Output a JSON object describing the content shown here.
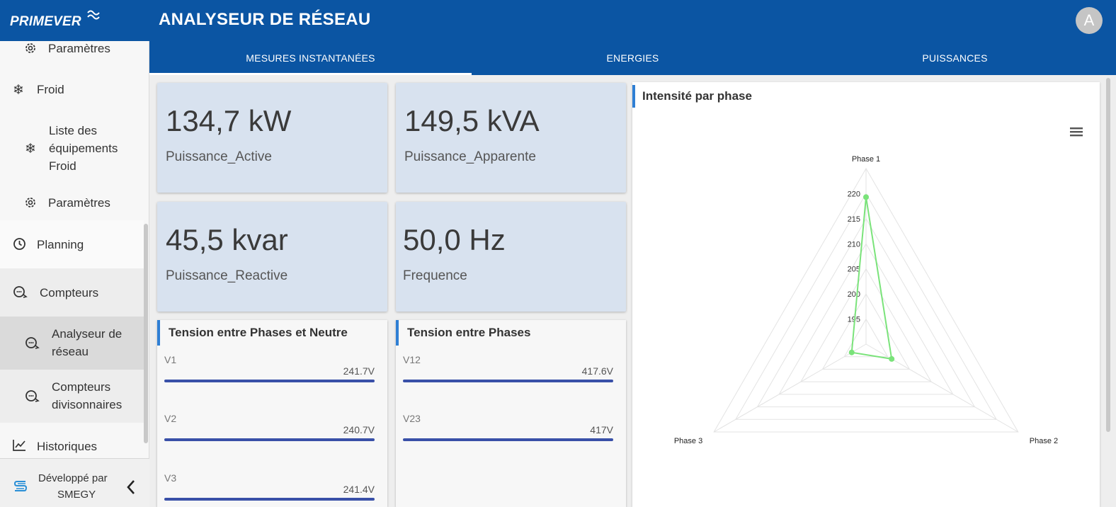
{
  "app": {
    "logo": "PRIMEVER",
    "title": "ANALYSEUR DE RÉSEAU",
    "avatar_initial": "A"
  },
  "tabs": [
    {
      "label": "MESURES INSTANTANÉES",
      "active": true
    },
    {
      "label": "ENERGIES",
      "active": false
    },
    {
      "label": "PUISSANCES",
      "active": false
    }
  ],
  "sidebar": {
    "items": [
      {
        "label": "Paramètres",
        "icon": "gear-icon"
      },
      {
        "label": "Froid",
        "icon": "snowflake-icon"
      },
      {
        "label_lines": [
          "Liste des",
          "équipements",
          "Froid"
        ],
        "icon": "snowflake-icon"
      },
      {
        "label": "Paramètres",
        "icon": "gear-icon"
      },
      {
        "label": "Planning",
        "icon": "clock-icon"
      },
      {
        "label": "Compteurs",
        "icon": "meter-icon"
      },
      {
        "label_lines": [
          "Analyseur de",
          "réseau"
        ],
        "icon": "meter-icon",
        "active": true
      },
      {
        "label_lines": [
          "Compteurs",
          "divisonnaires"
        ],
        "icon": "meter-icon"
      },
      {
        "label": "Historiques",
        "icon": "chart-line-icon"
      }
    ],
    "footer": {
      "line1": "Développé par",
      "line2": "SMEGY",
      "icon": "smegy-logo-icon",
      "collapse_icon": "chevron-left-icon"
    }
  },
  "metrics": [
    {
      "value": "134,7 kW",
      "label": "Puissance_Active"
    },
    {
      "value": "149,5 kVA",
      "label": "Puissance_Apparente"
    },
    {
      "value": "45,5 kvar",
      "label": "Puissance_Reactive"
    },
    {
      "value": "50,0 Hz",
      "label": "Frequence"
    }
  ],
  "tension_neutre": {
    "title": "Tension entre Phases et Neutre",
    "rows": [
      {
        "name": "V1",
        "value": "241.7V"
      },
      {
        "name": "V2",
        "value": "240.7V"
      },
      {
        "name": "V3",
        "value": "241.4V"
      }
    ]
  },
  "tension_phases": {
    "title": "Tension entre Phases",
    "rows": [
      {
        "name": "V12",
        "value": "417.6V"
      },
      {
        "name": "V23",
        "value": "417V"
      }
    ]
  },
  "chart_data": {
    "type": "radar",
    "title": "Intensité par phase",
    "categories": [
      "Phase 1",
      "Phase 2",
      "Phase 3"
    ],
    "axis_min": 190,
    "axis_max": 225,
    "ticks": [
      195,
      200,
      205,
      210,
      215,
      220
    ],
    "series": [
      {
        "values": [
          219.3,
          195.9,
          193.3
        ],
        "color": "#7ae37a"
      }
    ],
    "grid": true
  },
  "colors": {
    "header": "#0b55a3",
    "card": "#d8e2ef",
    "bar": "#3950a8",
    "accent": "#2f7fd4"
  }
}
